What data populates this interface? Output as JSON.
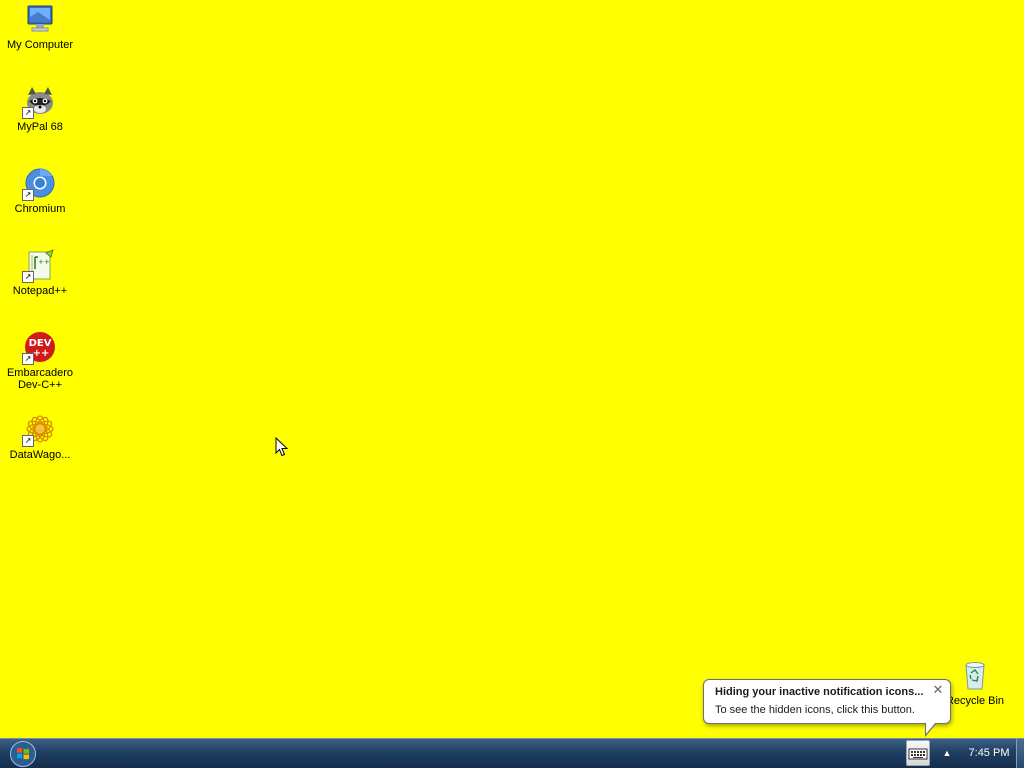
{
  "desktop": {
    "background_color": "#ffff00",
    "icons": [
      {
        "label": "My Computer",
        "icon": "computer-icon"
      },
      {
        "label": "MyPal 68",
        "icon": "raccoon-icon"
      },
      {
        "label": "Chromium",
        "icon": "chromium-icon"
      },
      {
        "label": "Notepad++",
        "icon": "notepad-plus-plus-icon"
      },
      {
        "label": "Embarcadero\nDev-C++",
        "icon": "dev-cpp-icon"
      },
      {
        "label": "DataWago...",
        "icon": "datawagon-icon"
      },
      {
        "label": "Recycle Bin",
        "icon": "recycle-bin-icon"
      }
    ]
  },
  "balloon": {
    "title": "Hiding your inactive notification icons...",
    "text": "To see the hidden icons, click this button.",
    "close_glyph": "✕"
  },
  "taskbar": {
    "clock": "7:45 PM",
    "show_hidden_glyph": "▲",
    "start_icon": "windows-logo-icon",
    "tray_icon": "keyboard-icon"
  }
}
